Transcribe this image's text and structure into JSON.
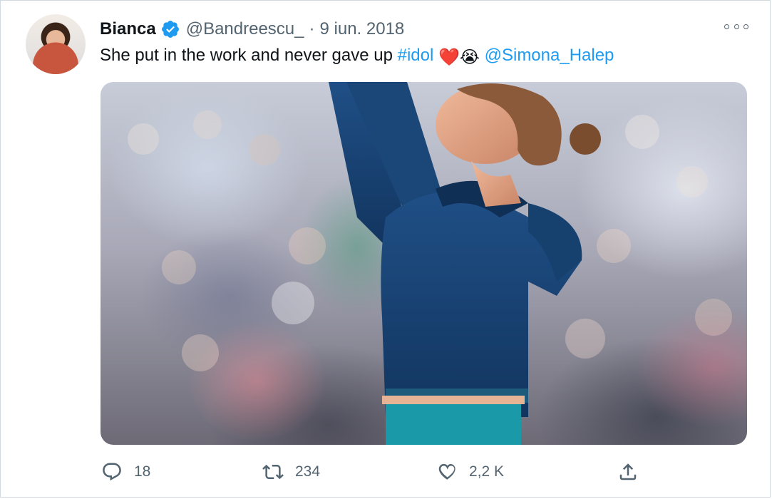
{
  "user": {
    "name": "Bianca",
    "handle": "@Bandreescu_",
    "separator": "·",
    "date": "9 iun. 2018"
  },
  "tweet": {
    "text": "She put in the work and never gave up ",
    "hashtag": "#idol",
    "emoji_heart": "❤️",
    "emoji_crying": "😭",
    "mention": "@Simona_Halep"
  },
  "actions": {
    "replies": "18",
    "retweets": "234",
    "likes": "2,2 K"
  },
  "colors": {
    "link": "#1d9bf0",
    "verified": "#1d9bf0",
    "secondary_text": "#536471"
  },
  "icons": [
    "verified-badge-icon",
    "more-icon",
    "reply-icon",
    "retweet-icon",
    "like-icon",
    "share-icon"
  ]
}
